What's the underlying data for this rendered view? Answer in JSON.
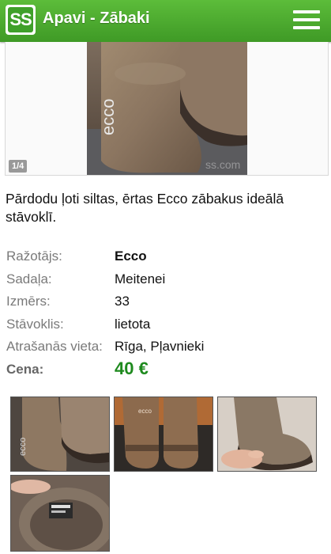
{
  "header": {
    "logo_text": "SS",
    "title": "Apavi - Zābaki",
    "menu_icon": "hamburger-menu-icon",
    "brand_color": "#4caf2f"
  },
  "gallery": {
    "counter": "1/4",
    "watermark_brand": "ecco",
    "watermark_site": "ss.com"
  },
  "description": "Pārdodu ļoti siltas, ērtas Ecco zābakus ideālā stāvoklī.",
  "properties": [
    {
      "label": "Ražotājs:",
      "value": "Ecco"
    },
    {
      "label": "Sadaļa:",
      "value": "Meitenei"
    },
    {
      "label": "Izmērs:",
      "value": "33"
    },
    {
      "label": "Stāvoklis:",
      "value": "lietota"
    },
    {
      "label": "Atrašanās vieta:",
      "value": "Rīga, Pļavnieki"
    }
  ],
  "price": {
    "label": "Cena:",
    "value": "40 €",
    "color": "#1e8a1e"
  },
  "thumbnails": [
    "boots-top-view",
    "boots-back-view",
    "boot-side-hand-view",
    "boot-inside-label-view"
  ]
}
